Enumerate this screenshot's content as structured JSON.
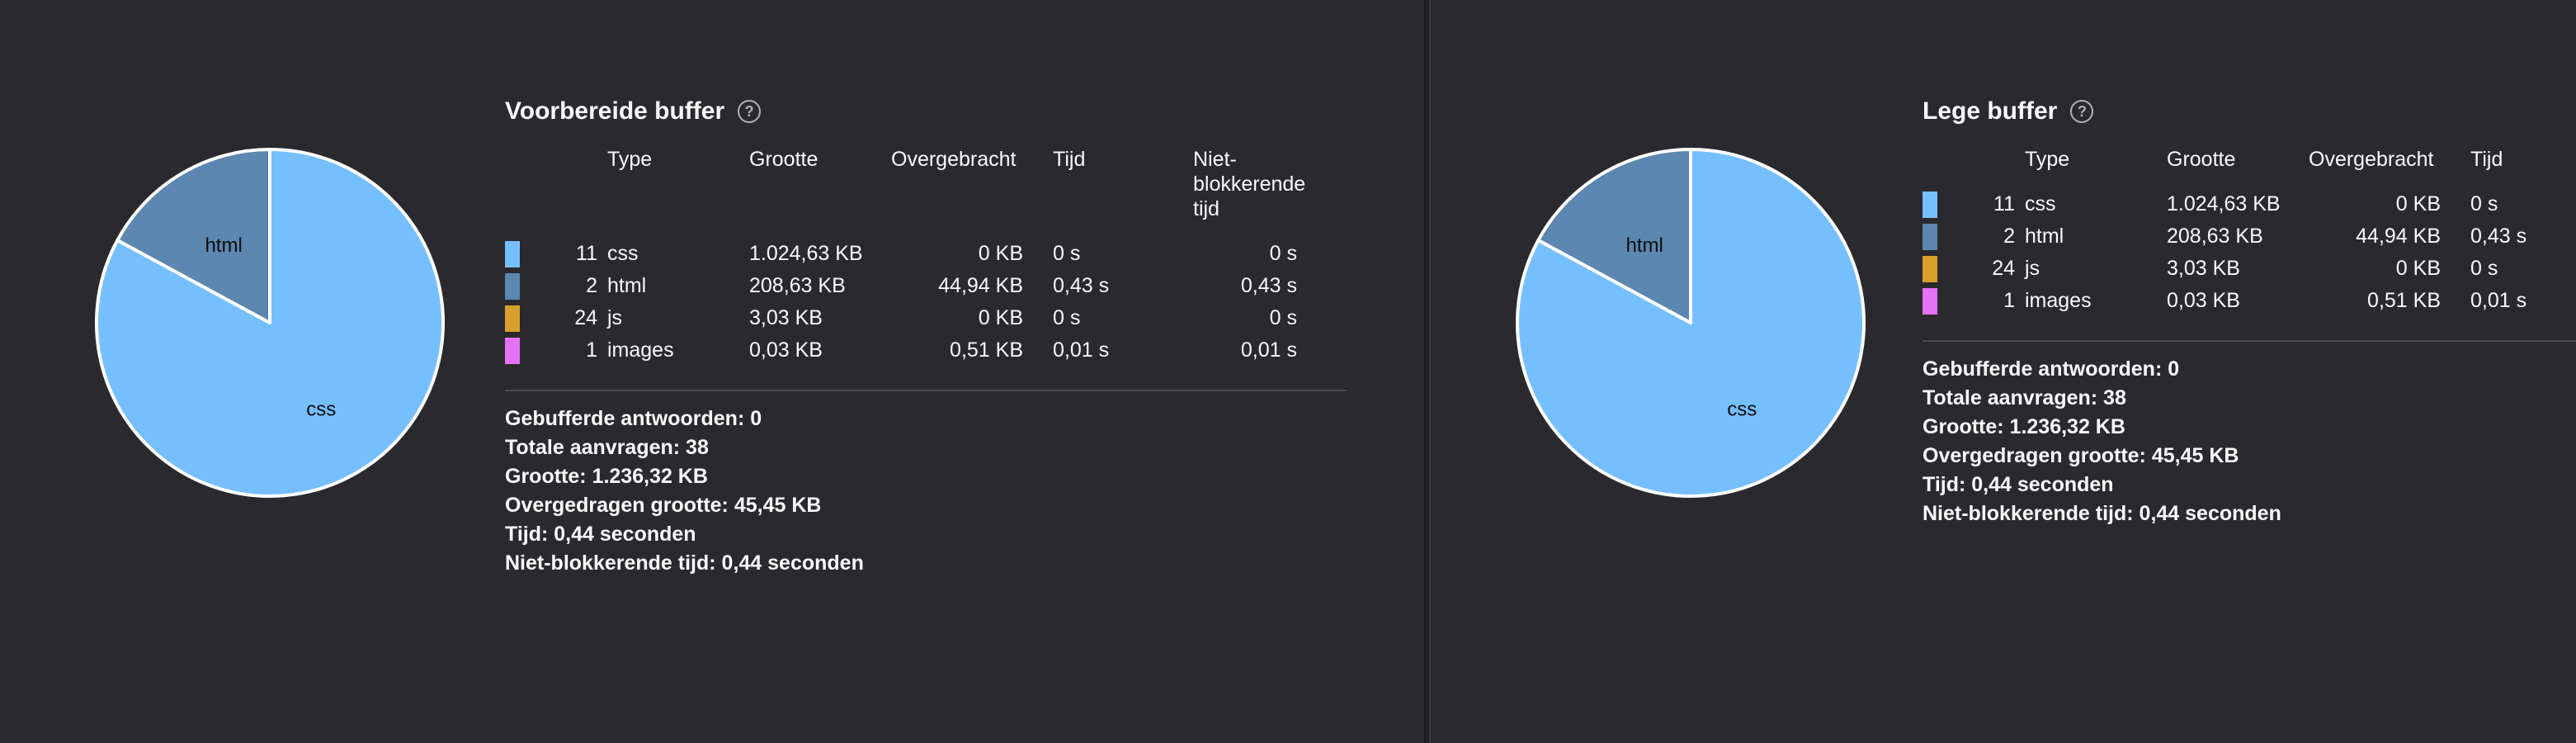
{
  "colors": {
    "css": "#75bfff",
    "html": "#5b87b0",
    "js": "#d7a02c",
    "images": "#e571f5",
    "background": "#2a2a2e"
  },
  "help_icon_glyph": "?",
  "panels": [
    {
      "title": "Voorbereide buffer",
      "headers": [
        "Type",
        "Grootte",
        "Overgebracht",
        "Tijd",
        "Niet-blokkerende tijd"
      ],
      "rows": [
        {
          "count": "11",
          "type": "css",
          "size": "1.024,63 KB",
          "transferred": "0 KB",
          "time": "0 s",
          "nonblocking": "0 s"
        },
        {
          "count": "2",
          "type": "html",
          "size": "208,63 KB",
          "transferred": "44,94 KB",
          "time": "0,43 s",
          "nonblocking": "0,43 s"
        },
        {
          "count": "24",
          "type": "js",
          "size": "3,03 KB",
          "transferred": "0 KB",
          "time": "0 s",
          "nonblocking": "0 s"
        },
        {
          "count": "1",
          "type": "images",
          "size": "0,03 KB",
          "transferred": "0,51 KB",
          "time": "0,01 s",
          "nonblocking": "0,01 s"
        }
      ],
      "stats": [
        "Gebufferde antwoorden: 0",
        "Totale aanvragen: 38",
        "Grootte: 1.236,32 KB",
        "Overgedragen grootte: 45,45 KB",
        "Tijd: 0,44 seconden",
        "Niet-blokkerende tijd: 0,44 seconden"
      ],
      "pie_labels": [
        "css",
        "html"
      ]
    },
    {
      "title": "Lege buffer",
      "headers": [
        "Type",
        "Grootte",
        "Overgebracht",
        "Tijd"
      ],
      "rows": [
        {
          "count": "11",
          "type": "css",
          "size": "1.024,63 KB",
          "transferred": "0 KB",
          "time": "0 s"
        },
        {
          "count": "2",
          "type": "html",
          "size": "208,63 KB",
          "transferred": "44,94 KB",
          "time": "0,43 s"
        },
        {
          "count": "24",
          "type": "js",
          "size": "3,03 KB",
          "transferred": "0 KB",
          "time": "0 s"
        },
        {
          "count": "1",
          "type": "images",
          "size": "0,03 KB",
          "transferred": "0,51 KB",
          "time": "0,01 s"
        }
      ],
      "stats": [
        "Gebufferde antwoorden: 0",
        "Totale aanvragen: 38",
        "Grootte: 1.236,32 KB",
        "Overgedragen grootte: 45,45 KB",
        "Tijd: 0,44 seconden",
        "Niet-blokkerende tijd: 0,44 seconden"
      ],
      "pie_labels": [
        "css",
        "html"
      ]
    }
  ],
  "pie_data": {
    "type": "pie",
    "slices": [
      {
        "label": "css",
        "share": 0.829
      },
      {
        "label": "html",
        "share": 0.169
      },
      {
        "label": "js",
        "share": 0.002
      },
      {
        "label": "images",
        "share": 0.0
      }
    ]
  }
}
